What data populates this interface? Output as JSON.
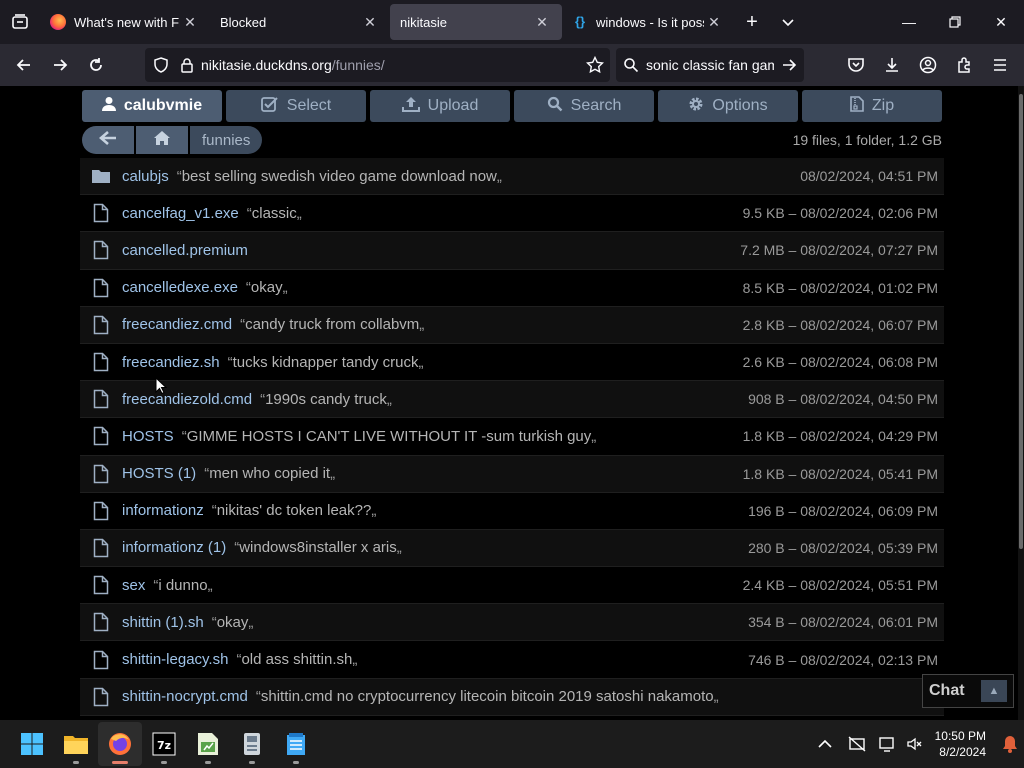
{
  "tabs": [
    {
      "title": "What's new with Firefo",
      "favicon": "firefox-icon"
    },
    {
      "title": "Blocked",
      "favicon": "blank"
    },
    {
      "title": "nikitasie",
      "favicon": "blank",
      "active": true
    },
    {
      "title": "windows - Is it possible",
      "favicon": "code-braces-icon"
    }
  ],
  "nav": {
    "url_host": "nikitasie.duckdns.org",
    "url_path": "/funnies/",
    "search_value": "sonic classic fan gam"
  },
  "toolbar": {
    "user": "calubvmie",
    "select": "Select",
    "upload": "Upload",
    "search": "Search",
    "options": "Options",
    "zip": "Zip"
  },
  "breadcrumb": {
    "dir": "funnies"
  },
  "summary": "19 files, 1 folder, 1.2 GB",
  "files": [
    {
      "name": "calubjs",
      "desc": "best selling swedish video game download now",
      "meta": "08/02/2024, 04:51 PM",
      "type": "folder"
    },
    {
      "name": "cancelfag_v1.exe",
      "desc": "classic",
      "meta": "9.5 KB – 08/02/2024, 02:06 PM",
      "type": "file"
    },
    {
      "name": "cancelled.premium",
      "desc": "",
      "meta": "7.2 MB – 08/02/2024, 07:27 PM",
      "type": "file"
    },
    {
      "name": "cancelledexe.exe",
      "desc": "okay",
      "meta": "8.5 KB – 08/02/2024, 01:02 PM",
      "type": "file"
    },
    {
      "name": "freecandiez.cmd",
      "desc": "candy truck from collabvm",
      "meta": "2.8 KB – 08/02/2024, 06:07 PM",
      "type": "file"
    },
    {
      "name": "freecandiez.sh",
      "desc": "tucks kidnapper tandy cruck",
      "meta": "2.6 KB – 08/02/2024, 06:08 PM",
      "type": "file"
    },
    {
      "name": "freecandiezold.cmd",
      "desc": "1990s candy truck",
      "meta": "908 B – 08/02/2024, 04:50 PM",
      "type": "file"
    },
    {
      "name": "HOSTS",
      "desc": "GIMME HOSTS I CAN'T LIVE WITHOUT IT -sum turkish guy",
      "meta": "1.8 KB – 08/02/2024, 04:29 PM",
      "type": "file"
    },
    {
      "name": "HOSTS (1)",
      "desc": "men who copied it",
      "meta": "1.8 KB – 08/02/2024, 05:41 PM",
      "type": "file"
    },
    {
      "name": "informationz",
      "desc": "nikitas' dc token leak??",
      "meta": "196 B – 08/02/2024, 06:09 PM",
      "type": "file"
    },
    {
      "name": "informationz (1)",
      "desc": "windows8installer x aris",
      "meta": "280 B – 08/02/2024, 05:39 PM",
      "type": "file"
    },
    {
      "name": "sex",
      "desc": "i dunno",
      "meta": "2.4 KB – 08/02/2024, 05:51 PM",
      "type": "file"
    },
    {
      "name": "shittin (1).sh",
      "desc": "okay",
      "meta": "354 B – 08/02/2024, 06:01 PM",
      "type": "file"
    },
    {
      "name": "shittin-legacy.sh",
      "desc": "old ass shittin.sh",
      "meta": "746 B – 08/02/2024, 02:13 PM",
      "type": "file"
    },
    {
      "name": "shittin-nocrypt.cmd",
      "desc": "shittin.cmd no cryptocurrency litecoin bitcoin 2019 satoshi nakamoto",
      "meta": "",
      "type": "file"
    }
  ],
  "chat": {
    "label": "Chat"
  },
  "clock": {
    "time": "10:50 PM",
    "date": "8/2/2024"
  },
  "colors": {
    "link": "#9fc3e8",
    "button": "#3c4a5c",
    "background": "#000000"
  }
}
